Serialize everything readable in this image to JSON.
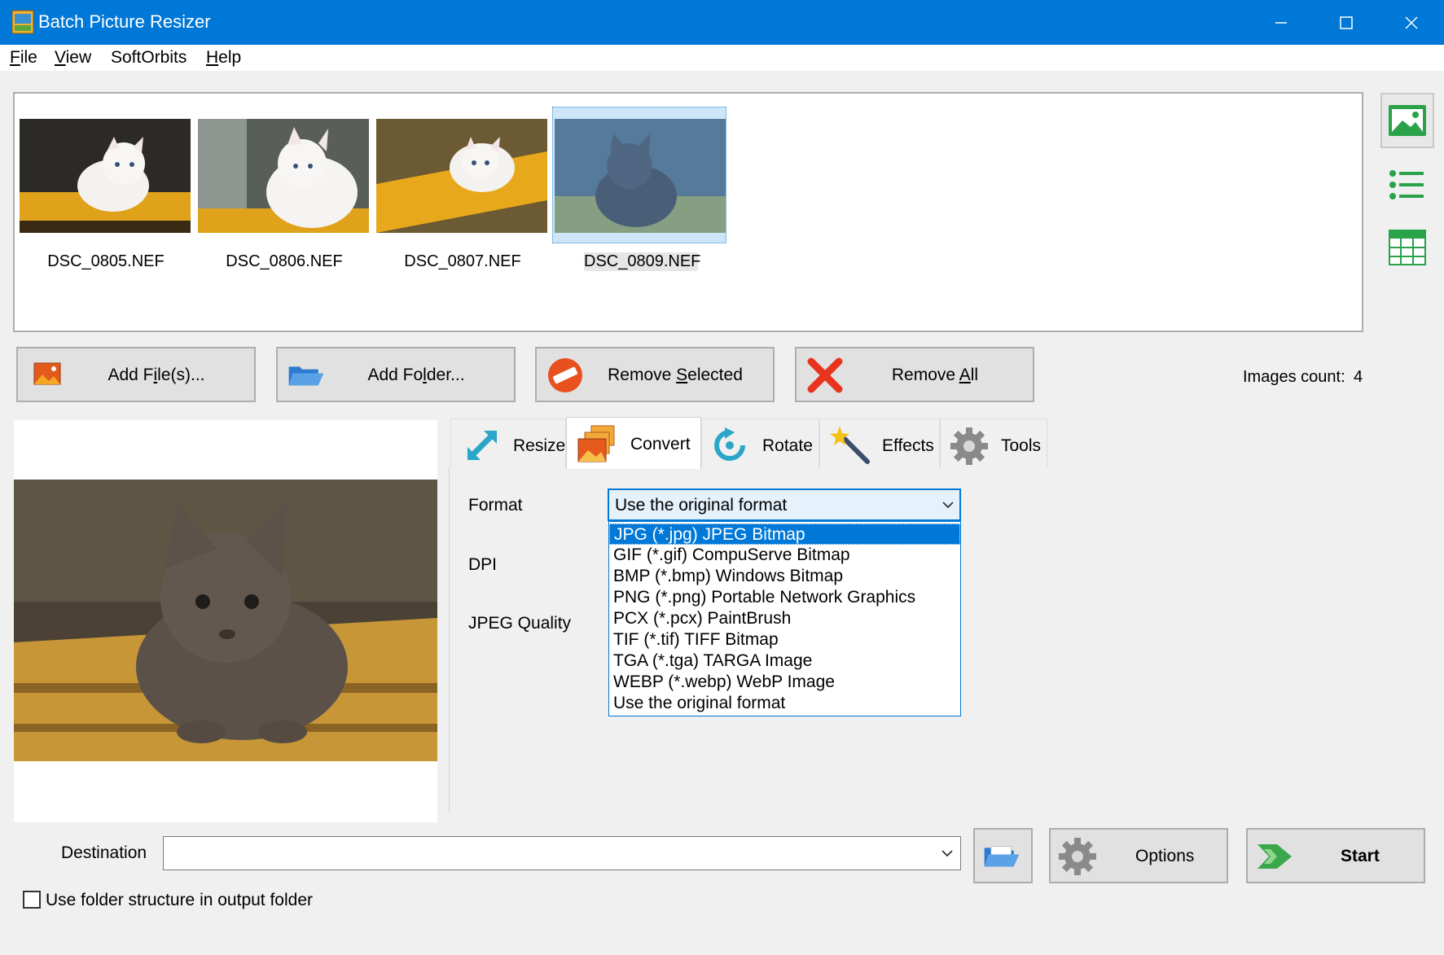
{
  "window": {
    "title": "Batch Picture Resizer",
    "accent": "#0078d7"
  },
  "menu": {
    "items": [
      {
        "label": "File",
        "mnemonic": "F",
        "rest": "ile"
      },
      {
        "label": "View",
        "mnemonic": "V",
        "rest": "iew"
      },
      {
        "label": "SoftOrbits",
        "mnemonic": "",
        "rest": "SoftOrbits"
      },
      {
        "label": "Help",
        "mnemonic": "H",
        "rest": "elp"
      }
    ]
  },
  "images": [
    {
      "name": "DSC_0805.NEF",
      "selected": false
    },
    {
      "name": "DSC_0806.NEF",
      "selected": false
    },
    {
      "name": "DSC_0807.NEF",
      "selected": false
    },
    {
      "name": "DSC_0809.NEF",
      "selected": true
    }
  ],
  "view_modes": [
    "thumbnails-icon",
    "list-icon",
    "table-icon"
  ],
  "actions": {
    "add_files": {
      "pre": "Add F",
      "mn": "i",
      "post": "le(s)..."
    },
    "add_folder": {
      "pre": "Add Fo",
      "mn": "l",
      "post": "der..."
    },
    "remove_selected": {
      "pre": "Remove ",
      "mn": "S",
      "post": "elected"
    },
    "remove_all": {
      "pre": "Remove ",
      "mn": "A",
      "post": "ll"
    }
  },
  "images_count": {
    "label": "Images count:",
    "value": "4"
  },
  "tabs": [
    {
      "label": "Resize",
      "active": false
    },
    {
      "label": "Convert",
      "active": true
    },
    {
      "label": "Rotate",
      "active": false
    },
    {
      "label": "Effects",
      "active": false
    },
    {
      "label": "Tools",
      "active": false
    }
  ],
  "convert": {
    "format_label": "Format",
    "dpi_label": "DPI",
    "jpeg_quality_label": "JPEG Quality",
    "format_value": "Use the original format",
    "format_options": [
      "JPG (*.jpg) JPEG Bitmap",
      "GIF (*.gif) CompuServe Bitmap",
      "BMP (*.bmp) Windows Bitmap",
      "PNG (*.png) Portable Network Graphics",
      "PCX (*.pcx) PaintBrush",
      "TIF (*.tif) TIFF Bitmap",
      "TGA (*.tga) TARGA Image",
      "WEBP (*.webp) WebP Image",
      "Use the original format"
    ],
    "highlighted_option": "JPG (*.jpg) JPEG Bitmap"
  },
  "destination": {
    "label": "Destination",
    "value": ""
  },
  "buttons": {
    "options": "Options",
    "start": "Start"
  },
  "folder_structure": {
    "label": "Use folder structure in output folder",
    "checked": false
  }
}
